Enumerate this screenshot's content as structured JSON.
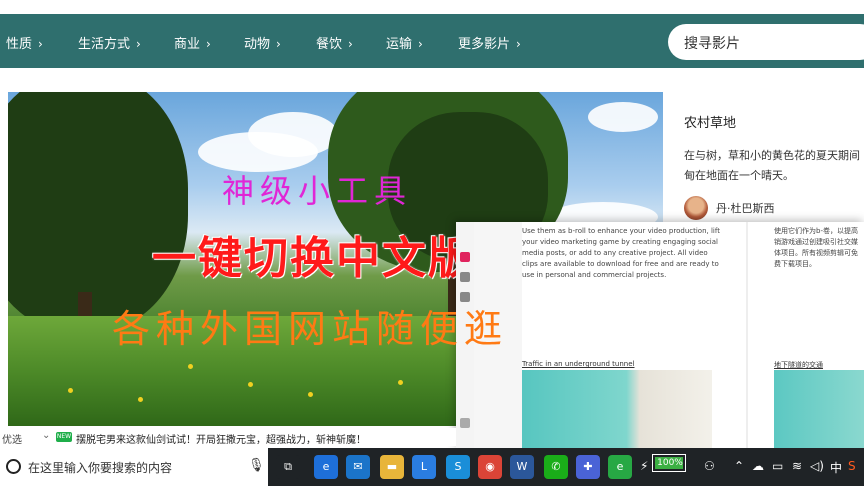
{
  "nav": {
    "items": [
      "性质",
      "生活方式",
      "商业",
      "动物",
      "餐饮",
      "运输",
      "更多影片"
    ],
    "chevron": "›",
    "search_placeholder": "搜寻影片"
  },
  "hero": {
    "overlay_line1": "神级小工具",
    "overlay_line2": "一键切换中文版",
    "overlay_line3": "各种外国网站随便逛"
  },
  "info": {
    "title": "农村草地",
    "description": "在与树，草和小的黄色花的夏天期间甸在地面在一个晴天。",
    "author": "丹·杜巴斯西"
  },
  "translated_page": {
    "english_text": "Use them as b-roll to enhance your video production, lift your video marketing game by creating engaging social media posts, or add to any creative project. All video clips are available to download for free and are ready to use in personal and commercial projects.",
    "chinese_text": "使用它们作为b-卷，以提高销游戏通过创建吸引社交媒体项目。所有视频剪辑可免费下载项目。",
    "caption_en": "Traffic in an underground tunnel",
    "caption_zh": "地下隧道的交通"
  },
  "ticker": {
    "label": "优选",
    "chevron": "⌄",
    "badge": "NEW",
    "text": "摆脱宅男来这款仙剑试试！开局狂撒元宝，超强战力，斩神斩魔！"
  },
  "taskbar": {
    "search_text": "在这里输入你要搜索的内容",
    "battery_text": "100%",
    "battery_level": 1.0,
    "ime_label": "中",
    "apps": [
      {
        "name": "task-view-icon",
        "glyph": "⧉",
        "color": "#1f2326"
      },
      {
        "name": "edge-icon",
        "glyph": "e",
        "color": "#1e6fd9"
      },
      {
        "name": "mail-icon",
        "glyph": "✉",
        "color": "#1b74c9"
      },
      {
        "name": "file-explorer-icon",
        "glyph": "▬",
        "color": "#e8b53a"
      },
      {
        "name": "lenovo-icon",
        "glyph": "L",
        "color": "#2a7de1"
      },
      {
        "name": "feiyu-icon",
        "glyph": "S",
        "color": "#1a8ed8"
      },
      {
        "name": "chrome-icon",
        "glyph": "◉",
        "color": "#db4437"
      },
      {
        "name": "word-icon",
        "glyph": "W",
        "color": "#2b579a"
      },
      {
        "name": "wechat-icon",
        "glyph": "✆",
        "color": "#1aad19"
      },
      {
        "name": "app-store-icon",
        "glyph": "✚",
        "color": "#4a63d6"
      },
      {
        "name": "360-icon",
        "glyph": "e",
        "color": "#27a844"
      }
    ]
  },
  "colors": {
    "nav_bg": "#2f6f6e",
    "overlay_magenta": "#e026d6",
    "overlay_red": "#ff1a1a",
    "overlay_orange": "#ff7a14",
    "taskbar_bg": "#1f2326"
  }
}
